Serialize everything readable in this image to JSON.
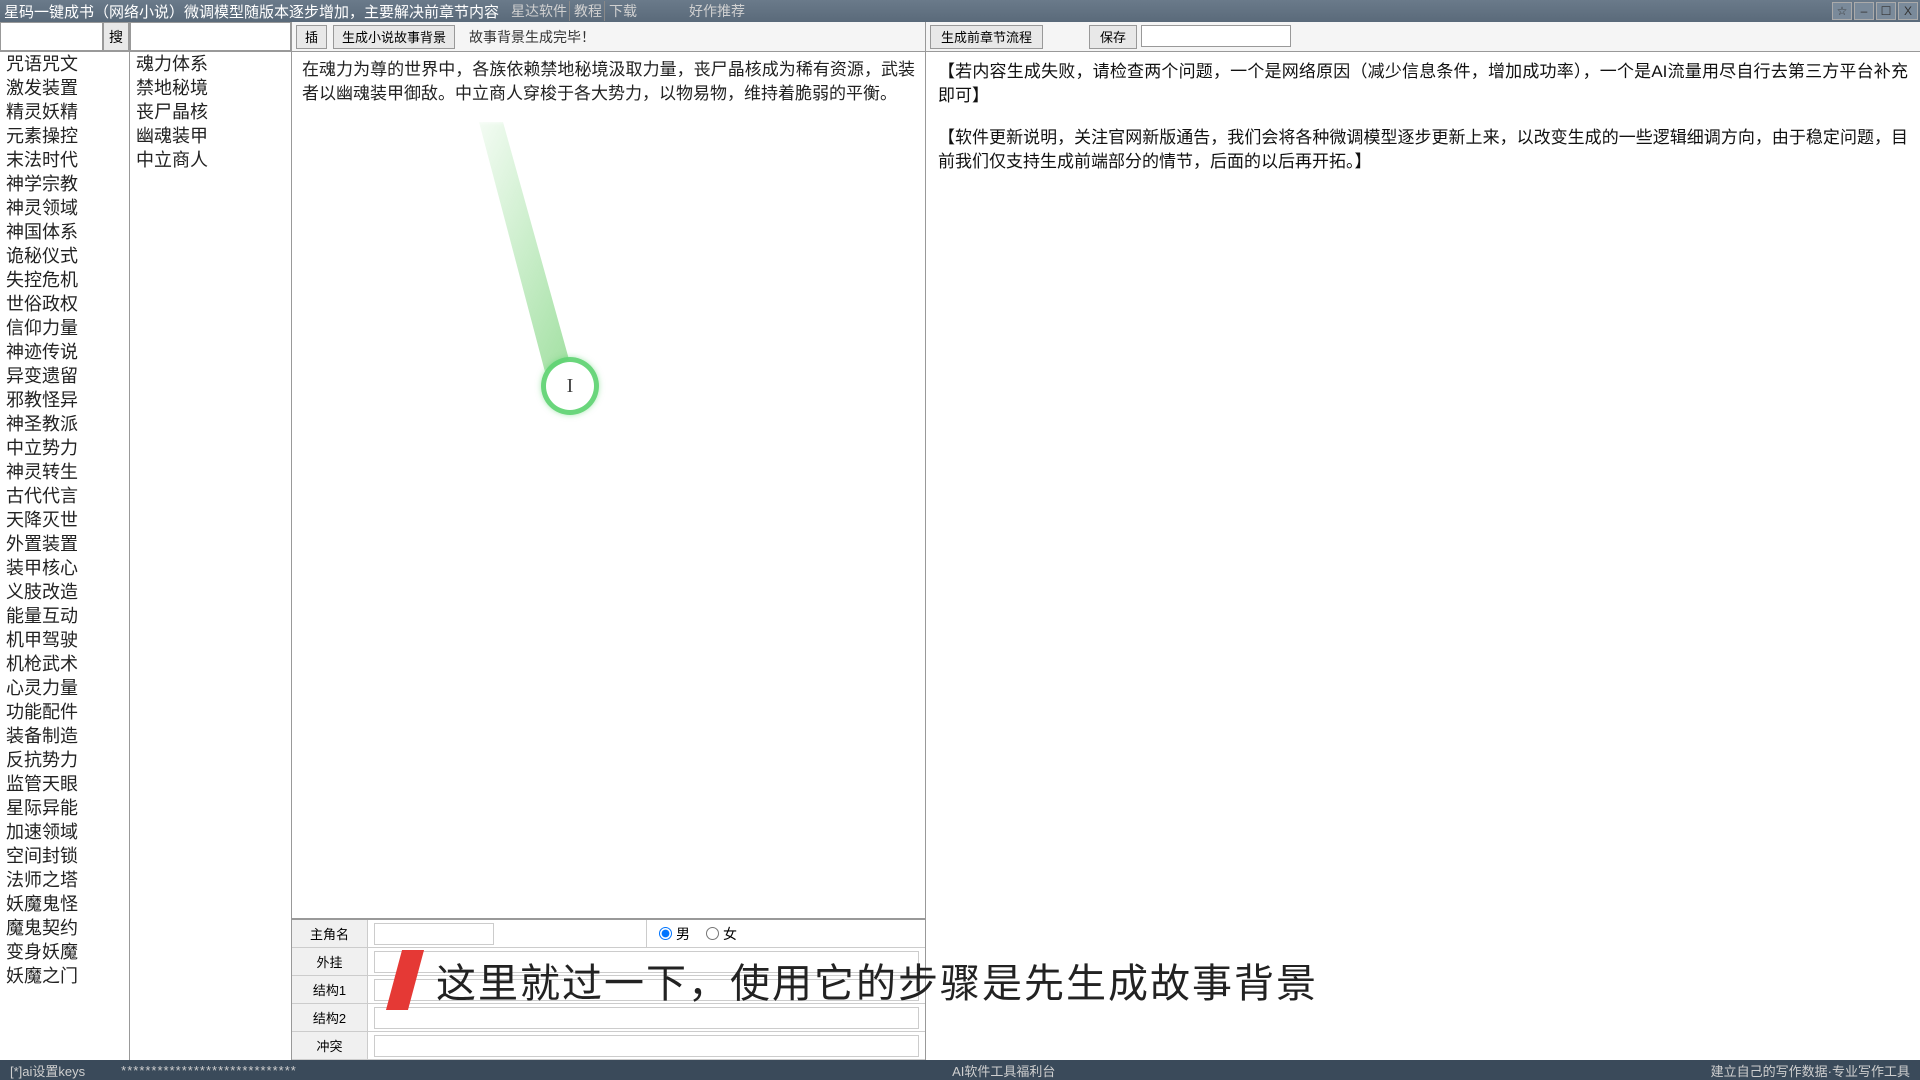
{
  "titlebar": {
    "title": "星码一键成书（网络小说）微调模型随版本逐步增加，主要解决前章节内容",
    "menu": [
      "星达软件",
      "教程",
      "下载"
    ],
    "good_rec": "好作推荐",
    "star_icon": "☆",
    "win_min": "–",
    "win_max": "☐",
    "win_close": "X"
  },
  "left": {
    "search_btn": "搜",
    "items": [
      "咒语咒文",
      "激发装置",
      "精灵妖精",
      "元素操控",
      "末法时代",
      "神学宗教",
      "神灵领域",
      "神国体系",
      "诡秘仪式",
      "失控危机",
      "世俗政权",
      "信仰力量",
      "神迹传说",
      "异变遗留",
      "邪教怪异",
      "神圣教派",
      "中立势力",
      "神灵转生",
      "古代代言",
      "天降灭世",
      "外置装置",
      "装甲核心",
      "义肢改造",
      "能量互动",
      "机甲驾驶",
      "机枪武术",
      "心灵力量",
      "功能配件",
      "装备制造",
      "反抗势力",
      "监管天眼",
      "星际异能",
      "加速领域",
      "空间封锁",
      "法师之塔",
      "妖魔鬼怪",
      "魔鬼契约",
      "变身妖魔",
      "妖魔之门"
    ]
  },
  "mid": {
    "items": [
      "魂力体系",
      "禁地秘境",
      "丧尸晶核",
      "幽魂装甲",
      "中立商人"
    ]
  },
  "center": {
    "btn_insert": "插",
    "btn_gen_bg": "生成小说故事背景",
    "status": "故事背景生成完毕！",
    "text": "在魂力为尊的世界中，各族依赖禁地秘境汲取力量，丧尸晶核成为稀有资源，武装者以幽魂装甲御敌。中立商人穿梭于各大势力，以物易物，维持着脆弱的平衡。"
  },
  "form": {
    "label_name": "主角名",
    "label_plugin": "外挂",
    "label_s1": "结构1",
    "label_s2": "结构2",
    "label_conflict": "冲突",
    "gender_m": "男",
    "gender_f": "女"
  },
  "right": {
    "btn_flow": "生成前章节流程",
    "btn_save": "保存",
    "p1": "【若内容生成失败，请检查两个问题，一个是网络原因（减少信息条件，增加成功率），一个是AI流量用尽自行去第三方平台补充即可】",
    "p2": "【软件更新说明，关注官网新版通告，我们会将各种微调模型逐步更新上来，以改变生成的一些逻辑细调方向，由于稳定问题，目前我们仅支持生成前端部分的情节，后面的以后再开拓。】"
  },
  "statusbar": {
    "left": "[*]ai设置keys",
    "pw": "*****************************",
    "mid": "AI软件工具福利台",
    "right": "建立自己的写作数据·专业写作工具"
  },
  "caption": "这里就过一下，使用它的步骤是先生成故事背景"
}
